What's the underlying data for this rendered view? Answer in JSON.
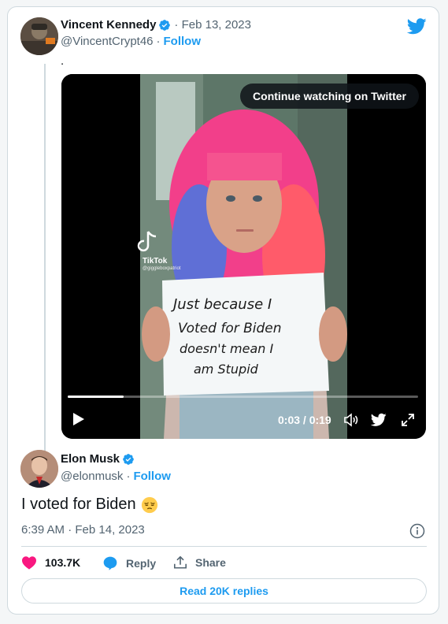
{
  "first_tweet": {
    "author_name": "Vincent Kennedy",
    "date": "· Feb 13, 2023",
    "handle": "@VincentCrypt46",
    "separator": "·",
    "follow_label": "Follow",
    "text": "."
  },
  "video": {
    "continue_label": "Continue watching on Twitter",
    "time": "0:03 / 0:19",
    "progress": 0.16,
    "watermark_brand": "TikTok",
    "watermark_handle": "@giggleboxpatriot",
    "sign_text": [
      "Just because I",
      "Voted for Biden",
      "doesn't mean I",
      "am Stupid"
    ]
  },
  "main_tweet": {
    "author_name": "Elon Musk",
    "handle": "@elonmusk",
    "separator": "·",
    "follow_label": "Follow",
    "text": "I voted for Biden",
    "emoji": "pensive-face",
    "timestamp": "6:39 AM · Feb 14, 2023"
  },
  "actions": {
    "like_count": "103.7K",
    "reply_label": "Reply",
    "share_label": "Share"
  },
  "read_replies_label": "Read 20K replies",
  "colors": {
    "accent": "#1d9bf0",
    "like": "#f91880",
    "muted": "#536471",
    "border": "#cfd9de"
  }
}
